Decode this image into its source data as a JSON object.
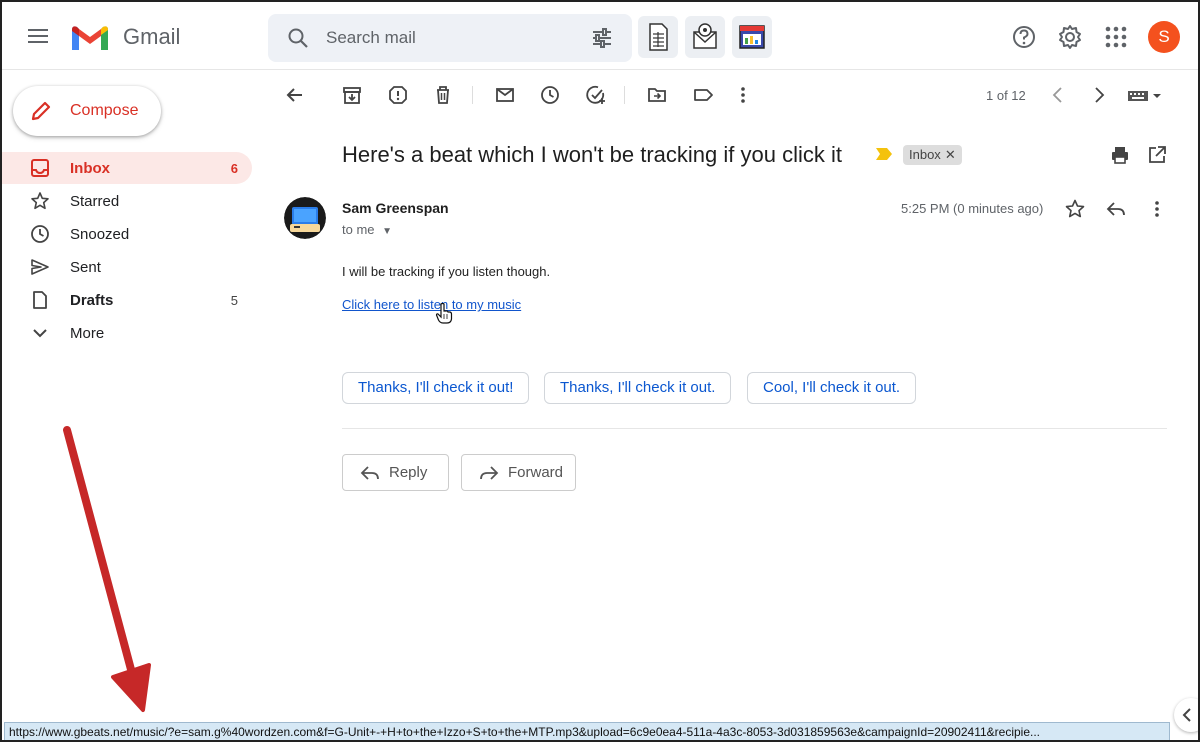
{
  "app": {
    "name": "Gmail",
    "search_placeholder": "Search mail",
    "avatar_initial": "S"
  },
  "sidebar": {
    "compose_label": "Compose",
    "items": [
      {
        "label": "Inbox",
        "count": "6",
        "icon": "inbox-icon",
        "active": true
      },
      {
        "label": "Starred",
        "count": "",
        "icon": "star-icon"
      },
      {
        "label": "Snoozed",
        "count": "",
        "icon": "clock-icon"
      },
      {
        "label": "Sent",
        "count": "",
        "icon": "send-icon"
      },
      {
        "label": "Drafts",
        "count": "5",
        "icon": "draft-icon"
      },
      {
        "label": "More",
        "count": "",
        "icon": "chevron-down-icon"
      }
    ]
  },
  "toolbar": {
    "pager": "1 of 12"
  },
  "email": {
    "subject": "Here's a beat which I won't be tracking if you click it",
    "label": "Inbox",
    "sender": "Sam Greenspan",
    "to": "to me",
    "time": "5:25 PM (0 minutes ago)",
    "body": "I will be tracking if you listen though.",
    "link_text": "Click here to listen to my music"
  },
  "smart_replies": [
    "Thanks, I'll check it out!",
    "Thanks, I'll check it out.",
    "Cool, I'll check it out."
  ],
  "actions": {
    "reply": "Reply",
    "forward": "Forward"
  },
  "status_url": "https://www.gbeats.net/music/?e=sam.g%40wordzen.com&f=G-Unit+-+H+to+the+Izzo+S+to+the+MTP.mp3&upload=6c9e0ea4-511a-4a3c-8053-3d031859563e&campaignId=20902411&recipie...",
  "colors": {
    "accent_red": "#d93025",
    "link_blue": "#1155cc",
    "button_blue": "#0b57d0",
    "avatar_orange": "#f4511e",
    "arrow_red": "#c62828",
    "status_bg": "#d6e8f5"
  }
}
